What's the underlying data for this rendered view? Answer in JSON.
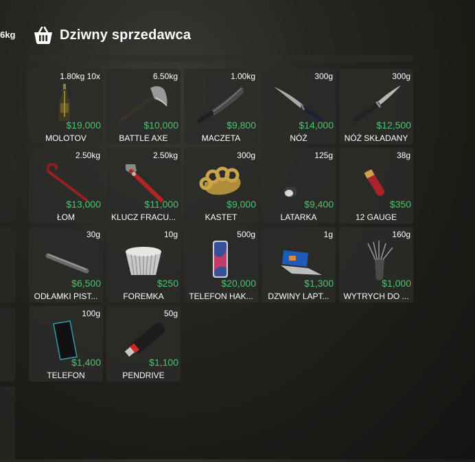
{
  "left_panel": {
    "weight": "6kg"
  },
  "header": {
    "title": "Dziwny sprzedawca",
    "icon": "basket-icon"
  },
  "items": [
    {
      "weight": "1.80kg 10x",
      "price": "$19,000",
      "name": "MOLOTOV",
      "icon": "molotov-icon"
    },
    {
      "weight": "6.50kg",
      "price": "$10,000",
      "name": "BATTLE AXE",
      "icon": "battle-axe-icon"
    },
    {
      "weight": "1.00kg",
      "price": "$9,800",
      "name": "MACZETA",
      "icon": "machete-icon"
    },
    {
      "weight": "300g",
      "price": "$14,000",
      "name": "NÓŻ",
      "icon": "knife-icon"
    },
    {
      "weight": "300g",
      "price": "$12,500",
      "name": "NÓŻ SKŁADANY",
      "icon": "folding-knife-icon"
    },
    {
      "weight": "2.50kg",
      "price": "$13,000",
      "name": "ŁOM",
      "icon": "crowbar-icon"
    },
    {
      "weight": "2.50kg",
      "price": "$11,000",
      "name": "KLUCZ FRACU...",
      "icon": "wrench-icon"
    },
    {
      "weight": "300g",
      "price": "$9,000",
      "name": "KASTET",
      "icon": "knuckles-icon"
    },
    {
      "weight": "125g",
      "price": "$9,400",
      "name": "LATARKA",
      "icon": "flashlight-icon"
    },
    {
      "weight": "38g",
      "price": "$350",
      "name": "12 GAUGE",
      "icon": "shotgun-shell-icon"
    },
    {
      "weight": "30g",
      "price": "$6,500",
      "name": "ODŁAMKI PIST...",
      "icon": "pistol-fragments-icon"
    },
    {
      "weight": "10g",
      "price": "$250",
      "name": "FOREMKA",
      "icon": "muffin-cup-icon"
    },
    {
      "weight": "500g",
      "price": "$20,000",
      "name": "TELEFON HAK...",
      "icon": "phone-icon"
    },
    {
      "weight": "1g",
      "price": "$1,300",
      "name": "DZWINY LAPT...",
      "icon": "laptop-icon"
    },
    {
      "weight": "160g",
      "price": "$1,000",
      "name": "WYTRYCH DO ...",
      "icon": "lockpick-icon"
    },
    {
      "weight": "100g",
      "price": "$1,400",
      "name": "TELEFON",
      "icon": "phone-black-icon"
    },
    {
      "weight": "50g",
      "price": "$1,100",
      "name": "PENDRIVE",
      "icon": "usb-drive-icon"
    }
  ],
  "colors": {
    "price": "#4dc36f",
    "card": "#2c2c29"
  }
}
